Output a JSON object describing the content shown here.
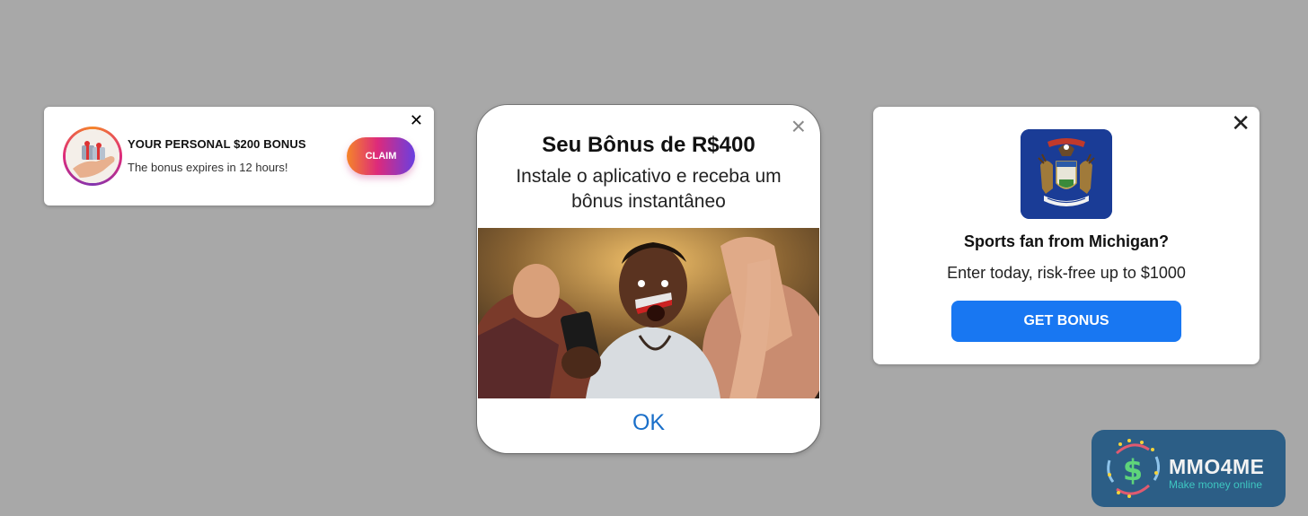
{
  "popup_personal_bonus": {
    "title": "YOUR PERSONAL $200 BONUS",
    "subtitle": "The bonus expires in 12 hours!",
    "claim_label": "CLAIM",
    "close_glyph": "✕",
    "avatar_icon": "gift-in-hand-icon",
    "accent_gradient": [
      "#f58529",
      "#dd2a7b",
      "#6a3fe0"
    ]
  },
  "popup_brazil_bonus": {
    "title": "Seu Bônus de R$400",
    "description": "Instale o aplicativo e receba um bônus instantâneo",
    "ok_label": "OK",
    "close_glyph": "×",
    "ok_color": "#1a6fc9",
    "photo": "excited-sports-fan-with-phone"
  },
  "popup_michigan": {
    "title": "Sports fan from Michigan?",
    "subtitle": "Enter today, risk-free up to $1000",
    "button_label": "GET BONUS",
    "close_glyph": "✕",
    "button_color": "#1877f2",
    "emblem": "michigan-state-flag-icon"
  },
  "watermark": {
    "brand": "MMO4ME",
    "tagline": "Make money online",
    "background": "#2c5e86"
  }
}
